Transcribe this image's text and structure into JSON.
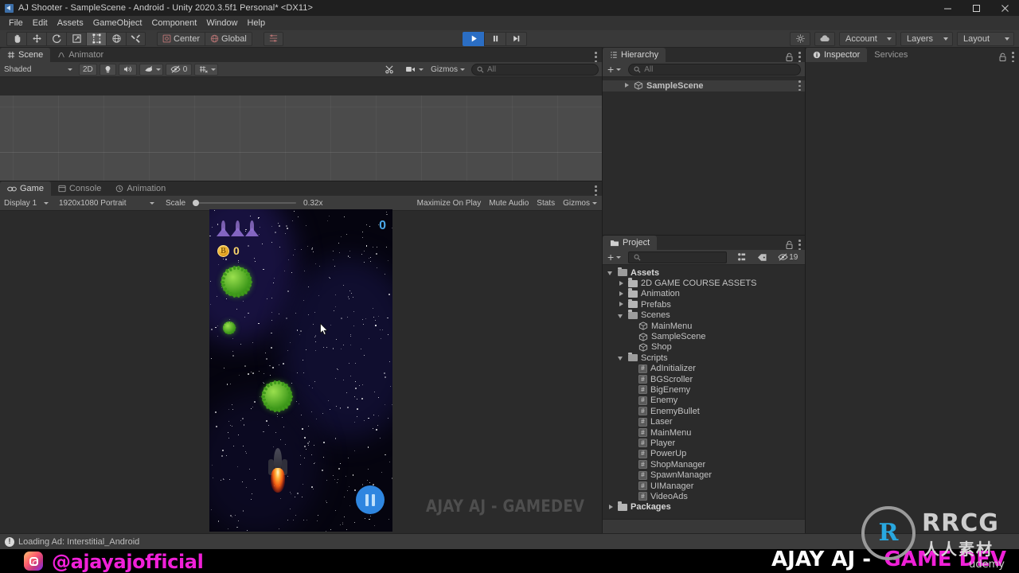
{
  "window": {
    "title": "AJ Shooter - SampleScene - Android - Unity 2020.3.5f1 Personal* <DX11>",
    "minimize": "—",
    "maximize": "□",
    "close": "✕"
  },
  "menubar": {
    "items": [
      "File",
      "Edit",
      "Assets",
      "GameObject",
      "Component",
      "Window",
      "Help"
    ]
  },
  "toolbar": {
    "tools": [
      "hand-tool",
      "move-tool",
      "rotate-tool",
      "scale-tool",
      "rect-tool",
      "transform-tool",
      "custom-editor-tool"
    ],
    "active_tool_index": 4,
    "pivot_label": "Center",
    "space_label": "Global",
    "play": "play-icon",
    "pause": "pause-icon",
    "step": "step-icon",
    "play_active": true,
    "account_label": "Account",
    "layers_label": "Layers",
    "layout_label": "Layout",
    "cloud_icon": "cloud-icon",
    "collab_icon": "collab-icon"
  },
  "scene_panel": {
    "tabs": [
      {
        "label": "Scene",
        "icon": "scene-grid-icon",
        "active": true
      },
      {
        "label": "Animator",
        "icon": "animator-icon",
        "active": false
      }
    ],
    "shading_mode": "Shaded",
    "mode_2d": "2D",
    "lighting_icon": "lightbulb-icon",
    "audio_icon": "audio-icon",
    "fx_icon": "fx-icon",
    "hidden_count": "0",
    "grid_icon": "grid-visibility-icon",
    "camera_icon": "scene-camera-icon",
    "gizmos_label": "Gizmos",
    "search_placeholder": "All"
  },
  "game_panel": {
    "tabs": [
      {
        "label": "Game",
        "icon": "game-icon",
        "active": true
      },
      {
        "label": "Console",
        "icon": "console-icon",
        "active": false
      },
      {
        "label": "Animation",
        "icon": "animation-icon",
        "active": false
      }
    ],
    "display": "Display 1",
    "resolution": "1920x1080 Portrait",
    "scale_label": "Scale",
    "scale_value": "0.32x",
    "maximize_on_play": "Maximize On Play",
    "mute_audio": "Mute Audio",
    "stats": "Stats",
    "gizmos": "Gizmos",
    "watermark": "AJAY AJ - GAMEDEV"
  },
  "game_hud": {
    "lives": 3,
    "coins": "0",
    "score": "0",
    "pause_icon": "pause-icon"
  },
  "hierarchy": {
    "tab_label": "Hierarchy",
    "tab_icon": "hierarchy-icon",
    "add_label": "+",
    "search_placeholder": "All",
    "lock_icon": "lock-icon",
    "items": [
      {
        "label": "SampleScene",
        "icon": "scene-icon",
        "expandable": true,
        "expanded": false
      }
    ]
  },
  "project": {
    "tab_label": "Project",
    "tab_icon": "folder-icon",
    "add_label": "+",
    "search_placeholder": "",
    "lock_icon": "lock-icon",
    "hidden_count": "19",
    "tree": [
      {
        "label": "Assets",
        "indent": 0,
        "type": "folder",
        "arrow": "open",
        "bold": true
      },
      {
        "label": "2D GAME COURSE ASSETS",
        "indent": 1,
        "type": "folder",
        "arrow": "closed"
      },
      {
        "label": "Animation",
        "indent": 1,
        "type": "folder",
        "arrow": "closed"
      },
      {
        "label": "Prefabs",
        "indent": 1,
        "type": "folder",
        "arrow": "closed"
      },
      {
        "label": "Scenes",
        "indent": 1,
        "type": "folder",
        "arrow": "open"
      },
      {
        "label": "MainMenu",
        "indent": 2,
        "type": "scene",
        "arrow": "none"
      },
      {
        "label": "SampleScene",
        "indent": 2,
        "type": "scene",
        "arrow": "none"
      },
      {
        "label": "Shop",
        "indent": 2,
        "type": "scene",
        "arrow": "none"
      },
      {
        "label": "Scripts",
        "indent": 1,
        "type": "folder",
        "arrow": "open"
      },
      {
        "label": "AdInitializer",
        "indent": 2,
        "type": "script",
        "arrow": "none"
      },
      {
        "label": "BGScroller",
        "indent": 2,
        "type": "script",
        "arrow": "none"
      },
      {
        "label": "BigEnemy",
        "indent": 2,
        "type": "script",
        "arrow": "none"
      },
      {
        "label": "Enemy",
        "indent": 2,
        "type": "script",
        "arrow": "none"
      },
      {
        "label": "EnemyBullet",
        "indent": 2,
        "type": "script",
        "arrow": "none"
      },
      {
        "label": "Laser",
        "indent": 2,
        "type": "script",
        "arrow": "none"
      },
      {
        "label": "MainMenu",
        "indent": 2,
        "type": "script",
        "arrow": "none"
      },
      {
        "label": "Player",
        "indent": 2,
        "type": "script",
        "arrow": "none"
      },
      {
        "label": "PowerUp",
        "indent": 2,
        "type": "script",
        "arrow": "none"
      },
      {
        "label": "ShopManager",
        "indent": 2,
        "type": "script",
        "arrow": "none"
      },
      {
        "label": "SpawnManager",
        "indent": 2,
        "type": "script",
        "arrow": "none"
      },
      {
        "label": "UIManager",
        "indent": 2,
        "type": "script",
        "arrow": "none"
      },
      {
        "label": "VideoAds",
        "indent": 2,
        "type": "script",
        "arrow": "none"
      },
      {
        "label": "Packages",
        "indent": 0,
        "type": "folder",
        "arrow": "closed",
        "bold": true
      }
    ]
  },
  "inspector": {
    "tabs": [
      {
        "label": "Inspector",
        "icon": "info-icon",
        "active": true
      },
      {
        "label": "Services",
        "icon": "services-icon",
        "active": false
      }
    ],
    "lock_icon": "lock-icon"
  },
  "statusbar": {
    "icon": "warning-icon",
    "message": "Loading Ad: Interstitial_Android"
  },
  "banner": {
    "instagram_icon": "instagram-icon",
    "handle": "@ajayajofficial",
    "brand_white": "AJAY AJ - ",
    "brand_pink": "GAME DEV",
    "udemy": "udemy"
  },
  "watermark": {
    "logo_mark": "R",
    "brand": "RRCG",
    "brand_cn": "人人素材"
  },
  "colors": {
    "accent_blue": "#2b6ec4",
    "panel_bg": "#2b2b2b",
    "toolbar_bg": "#393939",
    "tab_active": "#3c3c3c",
    "pink": "#f020d8",
    "score_blue": "#4aa8e8",
    "coin_gold": "#f7d46b",
    "enemy_green": "#3f9a1b"
  }
}
